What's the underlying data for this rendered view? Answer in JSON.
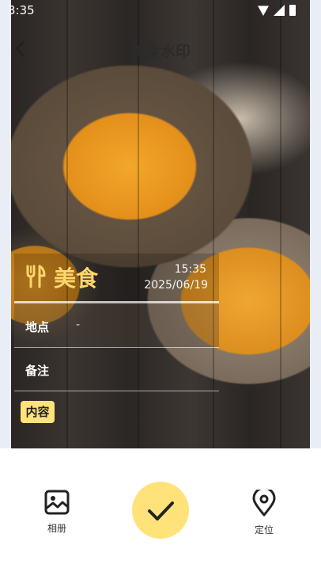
{
  "status": {
    "time": "3:35"
  },
  "header": {
    "title": "美食水印"
  },
  "watermark": {
    "category": "美食",
    "time": "15:35",
    "date": "2025/06/19",
    "location_label": "地点",
    "location_value": "-",
    "note_label": "备注",
    "content_label": "内容"
  },
  "toolbar": {
    "album_label": "相册",
    "location_label": "定位"
  },
  "colors": {
    "accent": "#ffe37a",
    "category_text": "#ffd66b"
  },
  "icons": [
    "back-arrow-icon",
    "fork-knife-icon",
    "image-icon",
    "check-icon",
    "location-pin-icon",
    "wifi-icon",
    "signal-icon",
    "battery-icon"
  ]
}
